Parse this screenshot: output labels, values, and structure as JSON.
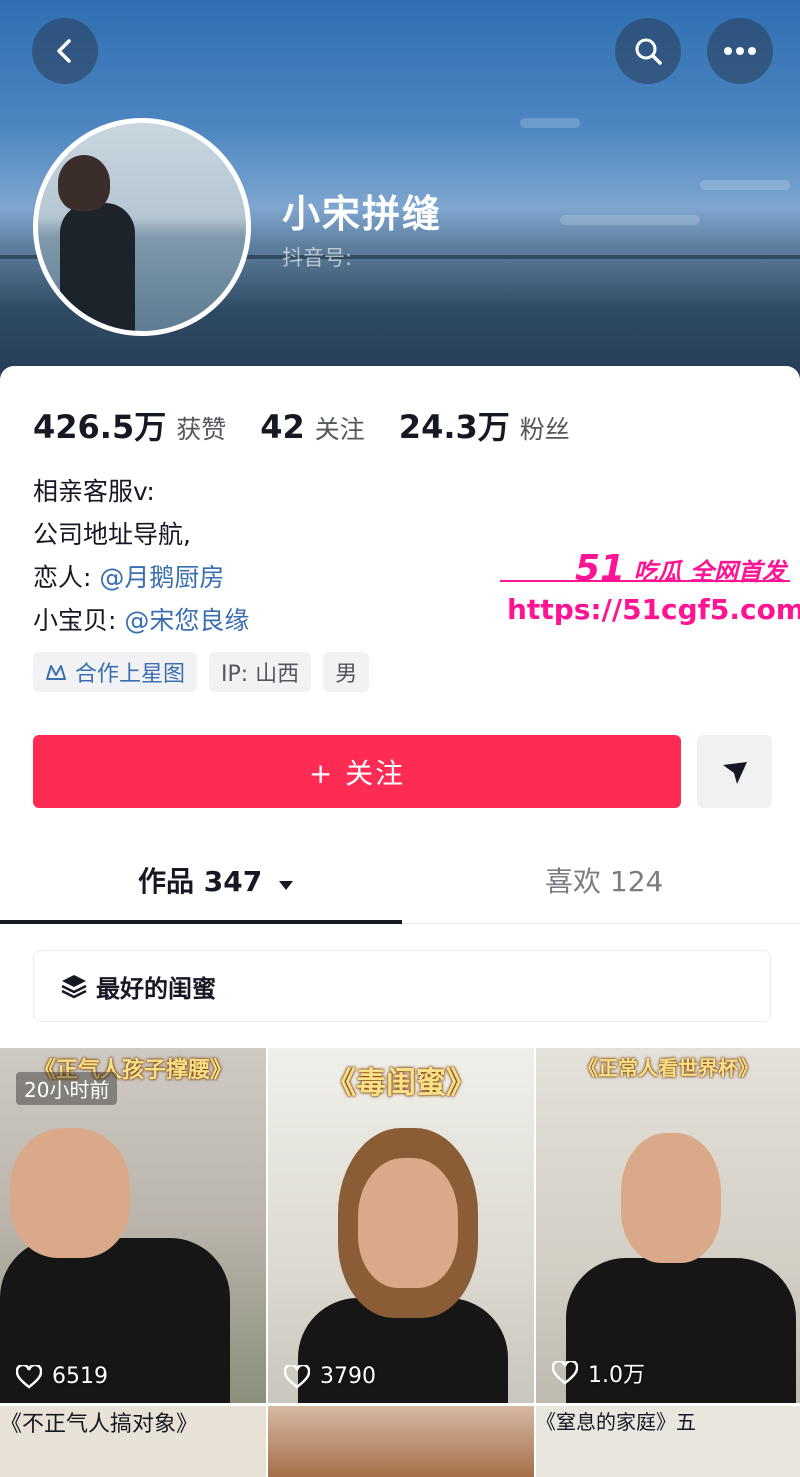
{
  "header": {
    "name": "小宋拼缝",
    "douyin_id_label": "抖音号:"
  },
  "stats": [
    {
      "value": "426.5万",
      "label": "获赞"
    },
    {
      "value": "42",
      "label": "关注"
    },
    {
      "value": "24.3万",
      "label": "粉丝"
    }
  ],
  "bio": {
    "line1": "相亲客服v:",
    "line2": "公司地址导航,",
    "line3_prefix": "恋人: ",
    "line3_mention": "@月鹅厨房",
    "line4_prefix": "小宝贝: ",
    "line4_mention": "@宋您良缘"
  },
  "tags": {
    "partner": "合作上星图",
    "ip": "IP: 山西",
    "gender": "男"
  },
  "actions": {
    "follow_label": "+ 关注"
  },
  "tabs": {
    "works_label": "作品 347",
    "likes_label": "喜欢 124"
  },
  "collection": {
    "label": "最好的闺蜜"
  },
  "videos": [
    {
      "title": "《正气人孩子撑腰》",
      "badge": "20小时前",
      "likes": "6519"
    },
    {
      "title": "《毒闺蜜》",
      "likes": "3790"
    },
    {
      "title": "《正常人看世界杯》",
      "likes": "1.0万"
    },
    {
      "title": "《不正气人搞对象》"
    },
    {
      "title": ""
    },
    {
      "title": "《窒息的家庭》五"
    }
  ],
  "watermark": {
    "brand_number": "51",
    "brand_text": "吃瓜 全网首发",
    "url": "https://51cgf5.com"
  },
  "colors": {
    "accent": "#fe2c55",
    "mention": "#3a6fb0",
    "watermark": "#ff1493"
  }
}
